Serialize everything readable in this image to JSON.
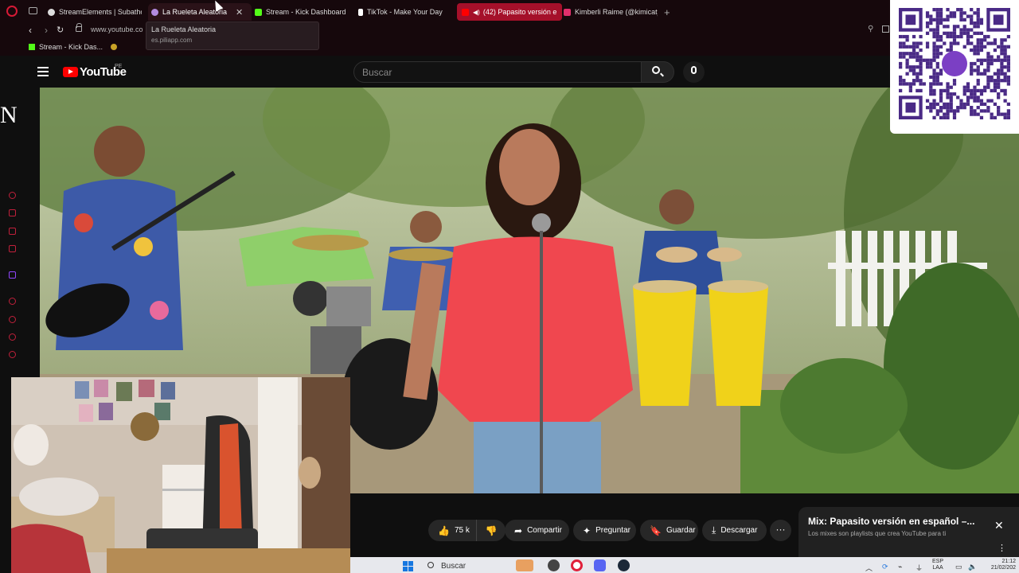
{
  "browser": {
    "tabs": [
      {
        "title": "StreamElements | Subathon",
        "favicon": "#dddddd",
        "active": false,
        "playing": false
      },
      {
        "title": "La Rueleta Aleatoria",
        "favicon": "#b38be0",
        "active": true,
        "playing": false
      },
      {
        "title": "Stream - Kick Dashboard",
        "favicon": "#53fc18",
        "active": false,
        "playing": false
      },
      {
        "title": "TikTok - Make Your Day",
        "favicon": "#ffffff",
        "active": false,
        "playing": false
      },
      {
        "title": "(42) Papasito versión e",
        "favicon": "#ff0000",
        "active": false,
        "playing": true
      },
      {
        "title": "Kimberli Raime (@kimicat_",
        "favicon": "#e1306c",
        "active": false,
        "playing": false
      }
    ],
    "new_tab_label": "+",
    "url": "www.youtube.co",
    "tooltip": {
      "title": "La Rueleta Aleatoria",
      "url": "es.piliapp.com"
    },
    "bookmarks": [
      {
        "label": "Stream - Kick Das..."
      }
    ]
  },
  "overlay": {
    "letter": "N"
  },
  "youtube": {
    "logo_text": "YouTube",
    "country_code": "PE",
    "search_placeholder": "Buscar",
    "actions": {
      "likes": "75 k",
      "share": "Compartir",
      "ask": "Preguntar",
      "save": "Guardar",
      "download": "Descargar",
      "more": "···"
    },
    "mix": {
      "title": "Mix: Papasito versión en español –...",
      "subtitle": "Los mixes son playlists que crea YouTube para ti"
    }
  },
  "taskbar": {
    "search_label": "Buscar",
    "language": "ESP",
    "language_sub": "LAA",
    "time": "21:12",
    "date": "21/02/202"
  },
  "colors": {
    "accent_red": "#ff0000",
    "opera_red": "#d51a36",
    "kick_green": "#53fc18"
  }
}
